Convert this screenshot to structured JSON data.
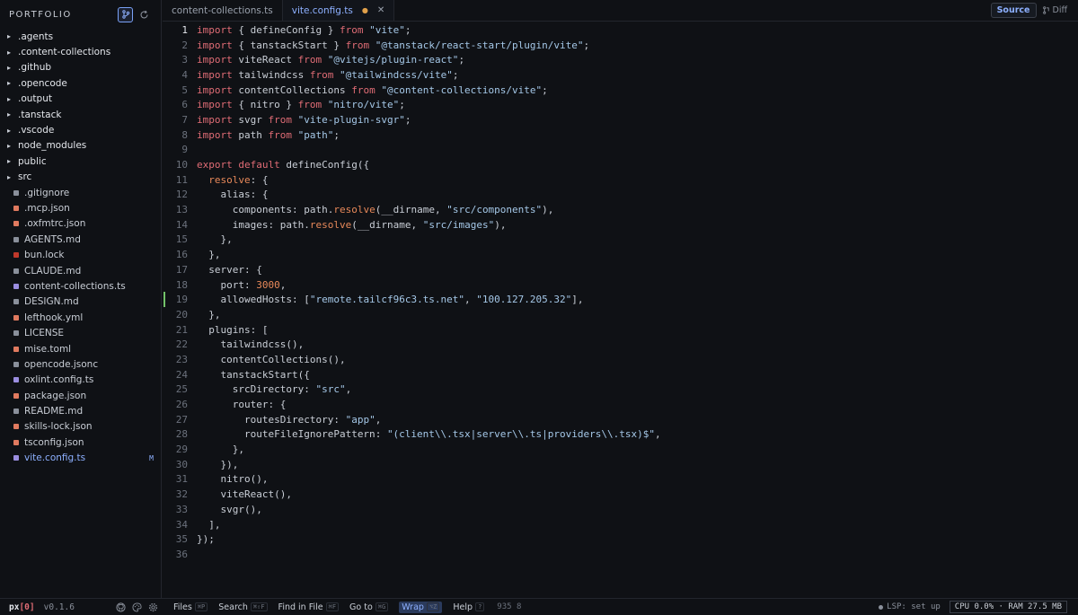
{
  "sidebar": {
    "title": "PORTFOLIO",
    "icons": [
      "git-branch-icon",
      "refresh-icon"
    ],
    "items": [
      {
        "label": ".agents",
        "type": "dir",
        "dim": false
      },
      {
        "label": ".content-collections",
        "type": "dir",
        "dim": true
      },
      {
        "label": ".github",
        "type": "dir",
        "dim": false
      },
      {
        "label": ".opencode",
        "type": "dir",
        "dim": false
      },
      {
        "label": ".output",
        "type": "dir",
        "dim": true
      },
      {
        "label": ".tanstack",
        "type": "dir",
        "dim": false
      },
      {
        "label": ".vscode",
        "type": "dir",
        "dim": true
      },
      {
        "label": "node_modules",
        "type": "dir",
        "dim": true
      },
      {
        "label": "public",
        "type": "dir",
        "dim": false
      },
      {
        "label": "src",
        "type": "dir",
        "dim": false
      },
      {
        "label": ".gitignore",
        "type": "file",
        "color": "#8a909b"
      },
      {
        "label": ".mcp.json",
        "type": "file",
        "color": "#e07a5f"
      },
      {
        "label": ".oxfmtrc.json",
        "type": "file",
        "color": "#e07a5f"
      },
      {
        "label": "AGENTS.md",
        "type": "file",
        "color": "#8a909b"
      },
      {
        "label": "bun.lock",
        "type": "file",
        "color": "#c0392b"
      },
      {
        "label": "CLAUDE.md",
        "type": "file",
        "color": "#8a909b"
      },
      {
        "label": "content-collections.ts",
        "type": "file",
        "color": "#9b8ee0"
      },
      {
        "label": "DESIGN.md",
        "type": "file",
        "color": "#8a909b"
      },
      {
        "label": "lefthook.yml",
        "type": "file",
        "color": "#e07a5f"
      },
      {
        "label": "LICENSE",
        "type": "file",
        "color": "#8a909b"
      },
      {
        "label": "mise.toml",
        "type": "file",
        "color": "#e07a5f"
      },
      {
        "label": "opencode.jsonc",
        "type": "file",
        "color": "#8a909b"
      },
      {
        "label": "oxlint.config.ts",
        "type": "file",
        "color": "#9b8ee0"
      },
      {
        "label": "package.json",
        "type": "file",
        "color": "#e07a5f"
      },
      {
        "label": "README.md",
        "type": "file",
        "color": "#8a909b"
      },
      {
        "label": "skills-lock.json",
        "type": "file",
        "color": "#e07a5f"
      },
      {
        "label": "tsconfig.json",
        "type": "file",
        "color": "#e07a5f"
      },
      {
        "label": "vite.config.ts",
        "type": "file",
        "color": "#9b8ee0",
        "selected": true,
        "badge": "M"
      }
    ]
  },
  "tabs": [
    {
      "label": "content-collections.ts",
      "active": false,
      "modified": false
    },
    {
      "label": "vite.config.ts",
      "active": true,
      "modified": true
    }
  ],
  "view_toggle": {
    "source": "Source",
    "diff": "Diff"
  },
  "editor": {
    "current_line": 1,
    "changed_line": 19,
    "lines": [
      "import { defineConfig } from \"vite\";",
      "import { tanstackStart } from \"@tanstack/react-start/plugin/vite\";",
      "import viteReact from \"@vitejs/plugin-react\";",
      "import tailwindcss from \"@tailwindcss/vite\";",
      "import contentCollections from \"@content-collections/vite\";",
      "import { nitro } from \"nitro/vite\";",
      "import svgr from \"vite-plugin-svgr\";",
      "import path from \"path\";",
      "",
      "export default defineConfig({",
      "  resolve: {",
      "    alias: {",
      "      components: path.resolve(__dirname, \"src/components\"),",
      "      images: path.resolve(__dirname, \"src/images\"),",
      "    },",
      "  },",
      "  server: {",
      "    port: 3000,",
      "    allowedHosts: [\"remote.tailcf96c3.ts.net\", \"100.127.205.32\"],",
      "  },",
      "  plugins: [",
      "    tailwindcss(),",
      "    contentCollections(),",
      "    tanstackStart({",
      "      srcDirectory: \"src\",",
      "      router: {",
      "        routesDirectory: \"app\",",
      "        routeFileIgnorePattern: \"(client\\\\.tsx|server\\\\.ts|providers\\\\.tsx)$\",",
      "      },",
      "    }),",
      "    nitro(),",
      "    viteReact(),",
      "    svgr(),",
      "  ],",
      "});",
      ""
    ]
  },
  "statusbar": {
    "brand": "px",
    "brand_bracket": "[0]",
    "version": "v0.1.6",
    "icons": [
      "github-icon",
      "palette-icon",
      "settings-icon"
    ],
    "commands": [
      {
        "label": "Files",
        "key": "⌘P"
      },
      {
        "label": "Search",
        "key": "⌘⇧F"
      },
      {
        "label": "Find in File",
        "key": "⌘F"
      },
      {
        "label": "Go to",
        "key": "⌘G"
      },
      {
        "label": "Wrap",
        "key": "⌥Z",
        "active": true
      },
      {
        "label": "Help",
        "key": "?"
      }
    ],
    "counts": "935 8",
    "lsp": "LSP: set up",
    "sysinfo": "CPU 0.0% · RAM 27.5 MB"
  },
  "colors": {
    "background": "#0f1115",
    "accent": "#8db0ff",
    "keyword": "#e06c75",
    "string": "#a5c8e8",
    "modified": "#e0a04a",
    "changed_gutter": "#73c26a"
  }
}
